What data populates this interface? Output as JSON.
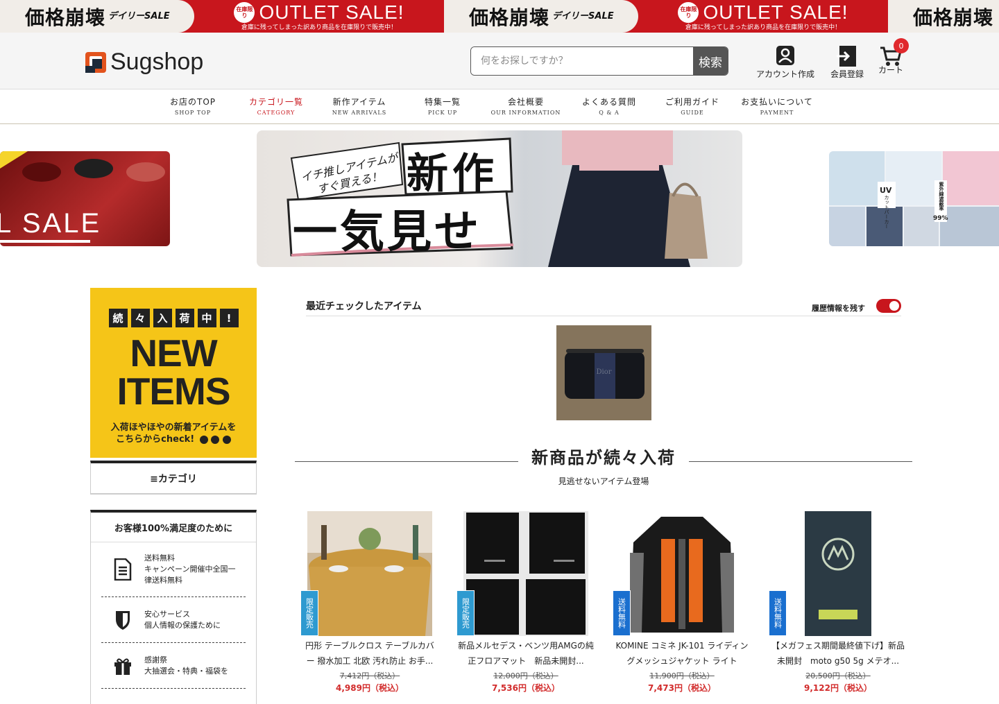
{
  "top_banner": {
    "headline": "価格崩壊",
    "headline_small": "デイリーSALE",
    "badge": "在庫限り",
    "outlet": "OUTLET SALE!",
    "sub": "倉庫に残ってしまった訳あり商品を在庫限りで販売中！",
    "color": "#c8161d"
  },
  "header": {
    "logo": "Sugshop",
    "search_placeholder": "何をお探しですか？",
    "search_button": "検索",
    "account_label": "アカウント作成",
    "register_label": "会員登録",
    "cart_label": "カート",
    "cart_count": "0"
  },
  "nav": [
    {
      "jp": "お店のTOP",
      "en": "SHOP TOP"
    },
    {
      "jp": "カテゴリ一覧",
      "en": "CATEGORY"
    },
    {
      "jp": "新作アイテム",
      "en": "NEW ARRIVALS"
    },
    {
      "jp": "特集一覧",
      "en": "PICK UP"
    },
    {
      "jp": "会社概要",
      "en": "OUR INFORMATION"
    },
    {
      "jp": "よくある質問",
      "en": "Q & A"
    },
    {
      "jp": "ご利用ガイド",
      "en": "GUIDE"
    },
    {
      "jp": "お支払いについて",
      "en": "PAYMENT"
    }
  ],
  "slider": {
    "left_text": "L SALE",
    "center_small_1": "イチ推しアイテムが",
    "center_small_2": "すぐ買える！",
    "center_big_1": "新作",
    "center_big_2": "一気見せ",
    "right_uv": "UV",
    "right_uv_sub": "カットパーカー",
    "right_side": "紫外線遮蔽率",
    "right_pct": "99%"
  },
  "sidebar": {
    "new_items_chars": [
      "続",
      "々",
      "入",
      "荷",
      "中",
      "!"
    ],
    "new_items_big_1": "NEW",
    "new_items_big_2": "ITEMS",
    "new_items_sub_1": "入荷ほやほやの新着アイテムを",
    "new_items_sub_2": "こちらからcheck!",
    "category_label": "≡カテゴリ",
    "satisfaction_title": "お客様100%満足度のために",
    "items": [
      {
        "line1": "送料無料",
        "line2": "キャンペーン開催中全国一",
        "line3": "律送料無料"
      },
      {
        "line1": "安心サービス",
        "line2": "個人情報の保護ために"
      },
      {
        "line1": "感謝祭",
        "line2": "大抽選会・特典・福袋を"
      }
    ]
  },
  "recent": {
    "title": "最近チェックしたアイテム",
    "history_label": "履歴情報を残す",
    "toggle_on": true,
    "item_brand": "Dior"
  },
  "new_section": {
    "title": "新商品が続々入荷",
    "subtitle": "見逃せないアイテム登場"
  },
  "products": [
    {
      "tag": "限定販売",
      "name": "円形 テーブルクロス テーブルカバー 撥水加工 北欧 汚れ防止 お手...",
      "old_price": "7,412円（税込）",
      "price": "4,989円（税込）"
    },
    {
      "tag": "限定販売",
      "name": "新品メルセデス・ベンツ用AMGの純正フロアマット　新品未開封...",
      "old_price": "12,000円（税込）",
      "price": "7,536円（税込）"
    },
    {
      "tag": "送料無料",
      "name": "KOMINE コミネ JK-101 ライディングメッシュジャケット ライト",
      "old_price": "11,900円（税込）",
      "price": "7,473円（税込）"
    },
    {
      "tag": "送料無料",
      "name": "【メガフェス期間最終値下げ】新品未開封　moto g50 5g メテオ...",
      "old_price": "20,500円（税込）",
      "price": "9,122円（税込）"
    }
  ]
}
